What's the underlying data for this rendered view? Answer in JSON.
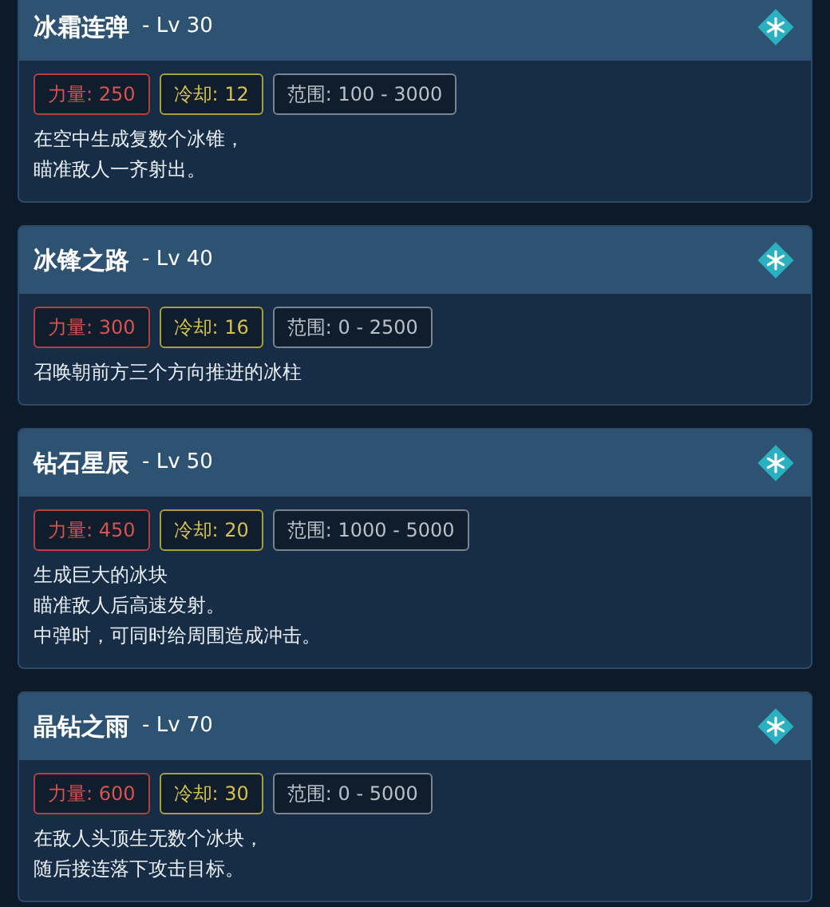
{
  "skills": [
    {
      "name": "冰霜连弹",
      "level": "- Lv 30",
      "stats": [
        {
          "kind": "power",
          "text": "力量: 250"
        },
        {
          "kind": "cooldown",
          "text": "冷却: 12"
        },
        {
          "kind": "range",
          "text": "范围: 100 - 3000"
        }
      ],
      "description": [
        "在空中生成复数个冰锥，",
        "瞄准敌人一齐射出。"
      ]
    },
    {
      "name": "冰锋之路",
      "level": "- Lv 40",
      "stats": [
        {
          "kind": "power",
          "text": "力量: 300"
        },
        {
          "kind": "cooldown",
          "text": "冷却: 16"
        },
        {
          "kind": "range",
          "text": "范围: 0 - 2500"
        }
      ],
      "description": [
        "召唤朝前方三个方向推进的冰柱"
      ]
    },
    {
      "name": "钻石星辰",
      "level": "- Lv 50",
      "stats": [
        {
          "kind": "power",
          "text": "力量: 450"
        },
        {
          "kind": "cooldown",
          "text": "冷却: 20"
        },
        {
          "kind": "range",
          "text": "范围: 1000 - 5000"
        }
      ],
      "description": [
        "生成巨大的冰块",
        "瞄准敌人后高速发射。",
        "中弹时，可同时给周围造成冲击。"
      ]
    },
    {
      "name": "晶钻之雨",
      "level": "- Lv 70",
      "stats": [
        {
          "kind": "power",
          "text": "力量: 600"
        },
        {
          "kind": "cooldown",
          "text": "冷却: 30"
        },
        {
          "kind": "range",
          "text": "范围: 0 - 5000"
        }
      ],
      "description": [
        "在敌人头顶生无数个冰块，",
        "随后接连落下攻击目标。"
      ]
    }
  ]
}
